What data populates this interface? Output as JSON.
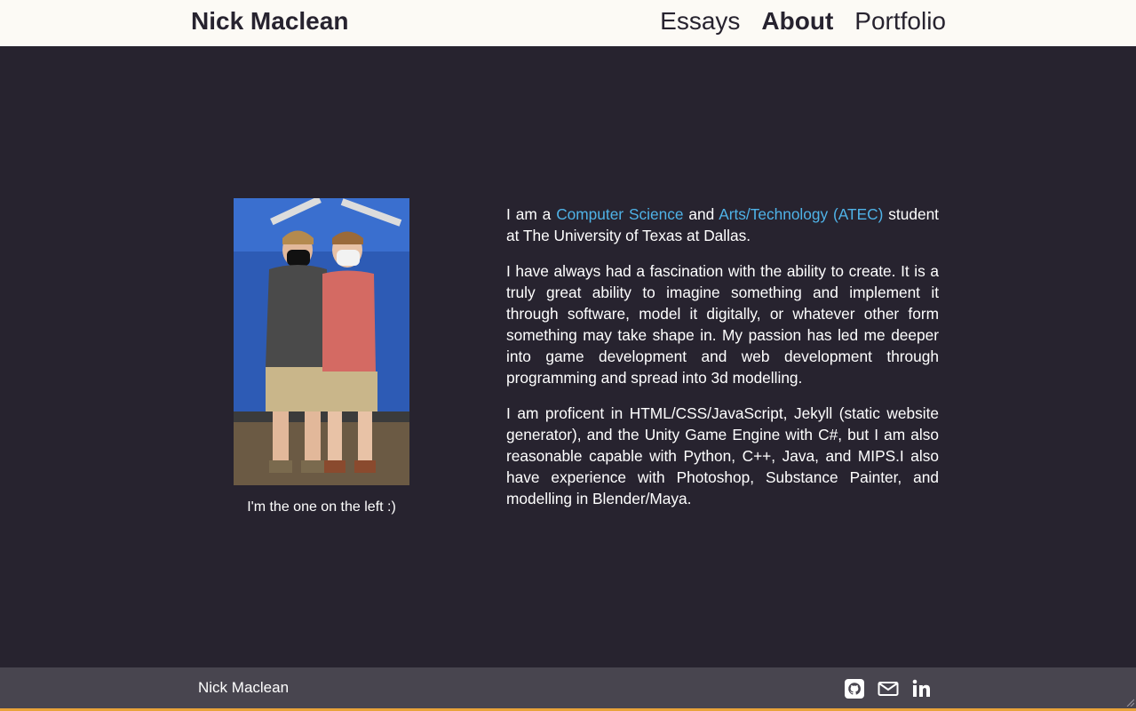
{
  "header": {
    "site_title": "Nick Maclean",
    "nav": [
      {
        "label": "Essays",
        "active": false
      },
      {
        "label": "About",
        "active": true
      },
      {
        "label": "Portfolio",
        "active": false
      }
    ]
  },
  "about": {
    "photo_caption": "I'm the one on the left :)",
    "p1": {
      "t1": "I am a ",
      "link1": "Computer Science",
      "t2": " and ",
      "link2": "Arts/Technology (ATEC)",
      "t3": " student at The University of Texas at Dallas."
    },
    "p2": "I have always had a fascination with the ability to create. It is a truly great ability to imagine something and implement it through software, model it digitally, or whatever other form something may take shape in. My passion has led me deeper into game development and web development through programming and spread into 3d modelling.",
    "p3": "I am proficent in HTML/CSS/JavaScript, Jekyll (static website generator), and the Unity Game Engine with C#, but I am also reasonable capable with Python, C++, Java, and MIPS.I also have experience with Photoshop, Substance Painter, and modelling in Blender/Maya."
  },
  "footer": {
    "name": "Nick Maclean",
    "social_icons": [
      "github-icon",
      "mail-icon",
      "linkedin-icon"
    ]
  },
  "colors": {
    "page_bg": "#27232f",
    "header_bg": "#fcfaf5",
    "footer_bg": "#48454f",
    "link": "#4fb3e8",
    "accent_bar": "#e8a33a"
  }
}
